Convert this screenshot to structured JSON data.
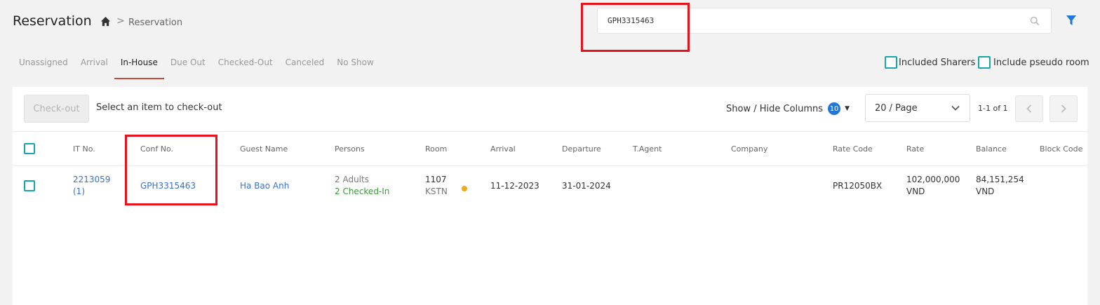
{
  "header": {
    "title": "Reservation",
    "breadcrumb_sep": ">",
    "breadcrumb_current": "Reservation",
    "search_value": "GPH3315463"
  },
  "tabs": [
    "Unassigned",
    "Arrival",
    "In-House",
    "Due Out",
    "Checked-Out",
    "Canceled",
    "No Show"
  ],
  "active_tab": "In-House",
  "options": {
    "included_sharers": "Included Sharers",
    "include_pseudo_room": "Include pseudo room"
  },
  "toolbar": {
    "checkout_label": "Check-out",
    "select_hint": "Select an item to check-out",
    "show_hide_label": "Show / Hide Columns",
    "columns_count": "10",
    "page_size": "20 / Page",
    "page_info": "1-1 of 1"
  },
  "table": {
    "columns": [
      "IT No.",
      "Conf No.",
      "Guest Name",
      "Persons",
      "Room",
      "Arrival",
      "Departure",
      "T.Agent",
      "Company",
      "Rate Code",
      "Rate",
      "Balance",
      "Block Code"
    ],
    "rows": [
      {
        "it_no": "2213059",
        "it_no_sub": "(1)",
        "conf_no": "GPH3315463",
        "guest_name": "Ha Bao Anh",
        "persons": "2 Adults",
        "persons_status": "2 Checked-In",
        "room": "1107",
        "room_type": "KSTN",
        "arrival": "11-12-2023",
        "departure": "31-01-2024",
        "t_agent": "",
        "company": "",
        "rate_code": "PR12050BX",
        "rate": "102,000,000",
        "rate_currency": "VND",
        "balance": "84,151,254",
        "balance_currency": "VND",
        "block_code": ""
      }
    ]
  },
  "colors": {
    "accent": "#2176d8",
    "teal": "#18a6ad",
    "highlight": "#e8111c",
    "tab_underline": "#c44a3a",
    "status_dot": "#f0a81d",
    "link": "#3a6fd1",
    "green": "#3a9a3a"
  },
  "icons": {
    "home": "home-icon",
    "search": "search-icon",
    "filter": "filter-icon",
    "chevron_down": "chevron-down-icon",
    "prev": "chevron-left-icon",
    "next": "chevron-right-icon"
  }
}
